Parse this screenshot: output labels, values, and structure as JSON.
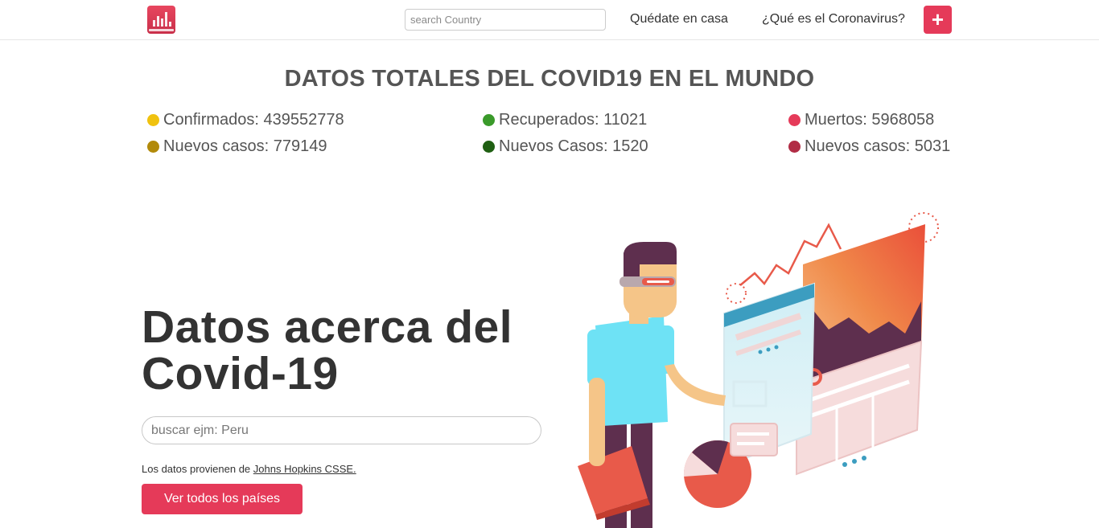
{
  "nav": {
    "search_placeholder": "search Country",
    "links": [
      "Quédate en casa",
      "¿Qué es el Coronavirus?"
    ],
    "plus_label": "+"
  },
  "stats": {
    "title": "DATOS TOTALES DEL COVID19 EN EL MUNDO",
    "items": [
      {
        "label": "Confirmados: 439552778",
        "color": "#f0c20f"
      },
      {
        "label": "Nuevos casos: 779149",
        "color": "#b28a0a"
      },
      {
        "label": "Recuperados: 11021",
        "color": "#3a9a2a"
      },
      {
        "label": "Nuevos Casos: 1520",
        "color": "#1f5f12"
      },
      {
        "label": "Muertos: 5968058",
        "color": "#e53a59"
      },
      {
        "label": "Nuevos casos: 5031",
        "color": "#b12c45"
      }
    ]
  },
  "hero": {
    "title_line1": "Datos acerca del",
    "title_line2": "Covid-19",
    "search_placeholder": "buscar ejm: Peru",
    "source_prefix": "Los datos provienen de ",
    "source_link": "Johns Hopkins CSSE.",
    "cta_label": "Ver todos los países"
  },
  "colors": {
    "accent": "#e53a59"
  }
}
